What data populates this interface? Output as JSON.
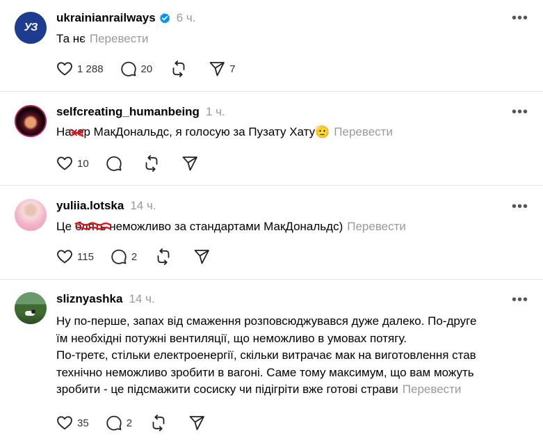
{
  "translate_label": "Перевести",
  "posts": [
    {
      "username": "ukrainianrailways",
      "verified": true,
      "avatar_text": "УЗ",
      "time": "6 ч.",
      "text": "Та нє",
      "likes": "1 288",
      "replies": "20",
      "shares": "7"
    },
    {
      "username": "selfcreating_humanbeing",
      "time": "1 ч.",
      "text": "Нахер МакДональдс, я голосую за Пузату Хату🫡",
      "likes": "10"
    },
    {
      "username": "yuliia.lotska",
      "time": "14 ч.",
      "text": "Це блять неможливо за стандартами МакДональдс)",
      "likes": "115",
      "replies": "2"
    },
    {
      "username": "sliznyashka",
      "time": "14 ч.",
      "text_lines": [
        "Ну по-перше, запах від смаження розповсюджувався дуже далеко. По-друге",
        "їм необхідні потужні вентиляції, що неможливо в умовах потягу.",
        "По-третє, стільки електроенергії, скільки витрачає мак на виготовлення став",
        "технічно неможливо зробити в вагоні. Саме тому максимум, що вам можуть",
        "зробити - це підсмажити сосиску чи підігріти вже готові страви"
      ],
      "likes": "35",
      "replies": "2"
    }
  ],
  "colors": {
    "verified": "#0095f6",
    "scribble": "#e0141a",
    "muted": "#999999"
  },
  "icons": [
    "heart-icon",
    "comment-icon",
    "repost-icon",
    "send-icon",
    "more-icon",
    "verified-badge-icon"
  ]
}
